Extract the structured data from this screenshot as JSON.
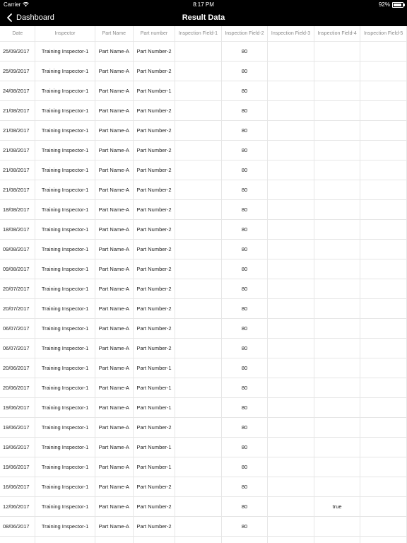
{
  "status_bar": {
    "carrier": "Carrier",
    "time": "8:17 PM",
    "battery": "92%",
    "battery_level": 0.92
  },
  "nav": {
    "back_label": "Dashboard",
    "title": "Result Data"
  },
  "table": {
    "columns": [
      "Date",
      "Inspector",
      "Part Name",
      "Part number",
      "Inspection Field-1",
      "Inspection Field-2",
      "Inspection Field-3",
      "Inspection Field-4",
      "Inspection Field-5"
    ],
    "rows": [
      [
        "25/09/2017",
        "Training Inspector-1",
        "Part Name-A",
        "Part Number-2",
        "",
        "80",
        "",
        "",
        ""
      ],
      [
        "25/09/2017",
        "Training Inspector-1",
        "Part Name-A",
        "Part Number-2",
        "",
        "80",
        "",
        "",
        ""
      ],
      [
        "24/08/2017",
        "Training Inspector-1",
        "Part Name-A",
        "Part Number-1",
        "",
        "80",
        "",
        "",
        ""
      ],
      [
        "21/08/2017",
        "Training Inspector-1",
        "Part Name-A",
        "Part Number-2",
        "",
        "80",
        "",
        "",
        ""
      ],
      [
        "21/08/2017",
        "Training Inspector-1",
        "Part Name-A",
        "Part Number-2",
        "",
        "80",
        "",
        "",
        ""
      ],
      [
        "21/08/2017",
        "Training Inspector-1",
        "Part Name-A",
        "Part Number-2",
        "",
        "80",
        "",
        "",
        ""
      ],
      [
        "21/08/2017",
        "Training Inspector-1",
        "Part Name-A",
        "Part Number-2",
        "",
        "80",
        "",
        "",
        ""
      ],
      [
        "21/08/2017",
        "Training Inspector-1",
        "Part Name-A",
        "Part Number-2",
        "",
        "80",
        "",
        "",
        ""
      ],
      [
        "18/08/2017",
        "Training Inspector-1",
        "Part Name-A",
        "Part Number-2",
        "",
        "80",
        "",
        "",
        ""
      ],
      [
        "18/08/2017",
        "Training Inspector-1",
        "Part Name-A",
        "Part Number-2",
        "",
        "80",
        "",
        "",
        ""
      ],
      [
        "09/08/2017",
        "Training Inspector-1",
        "Part Name-A",
        "Part Number-2",
        "",
        "80",
        "",
        "",
        ""
      ],
      [
        "09/08/2017",
        "Training Inspector-1",
        "Part Name-A",
        "Part Number-2",
        "",
        "80",
        "",
        "",
        ""
      ],
      [
        "20/07/2017",
        "Training Inspector-1",
        "Part Name-A",
        "Part Number-2",
        "",
        "80",
        "",
        "",
        ""
      ],
      [
        "20/07/2017",
        "Training Inspector-1",
        "Part Name-A",
        "Part Number-2",
        "",
        "80",
        "",
        "",
        ""
      ],
      [
        "06/07/2017",
        "Training Inspector-1",
        "Part Name-A",
        "Part Number-2",
        "",
        "80",
        "",
        "",
        ""
      ],
      [
        "06/07/2017",
        "Training Inspector-1",
        "Part Name-A",
        "Part Number-2",
        "",
        "80",
        "",
        "",
        ""
      ],
      [
        "20/06/2017",
        "Training Inspector-1",
        "Part Name-A",
        "Part Number-1",
        "",
        "80",
        "",
        "",
        ""
      ],
      [
        "20/06/2017",
        "Training Inspector-1",
        "Part Name-A",
        "Part Number-1",
        "",
        "80",
        "",
        "",
        ""
      ],
      [
        "19/06/2017",
        "Training Inspector-1",
        "Part Name-A",
        "Part Number-1",
        "",
        "80",
        "",
        "",
        ""
      ],
      [
        "19/06/2017",
        "Training Inspector-1",
        "Part Name-A",
        "Part Number-2",
        "",
        "80",
        "",
        "",
        ""
      ],
      [
        "19/06/2017",
        "Training Inspector-1",
        "Part Name-A",
        "Part Number-1",
        "",
        "80",
        "",
        "",
        ""
      ],
      [
        "19/06/2017",
        "Training Inspector-1",
        "Part Name-A",
        "Part Number-1",
        "",
        "80",
        "",
        "",
        ""
      ],
      [
        "16/06/2017",
        "Training Inspector-1",
        "Part Name-A",
        "Part Number-2",
        "",
        "80",
        "",
        "",
        ""
      ],
      [
        "12/06/2017",
        "Training Inspector-1",
        "Part Name-A",
        "Part Number-2",
        "",
        "80",
        "",
        "true",
        ""
      ],
      [
        "08/06/2017",
        "Training Inspector-1",
        "Part Name-A",
        "Part Number-2",
        "",
        "80",
        "",
        "",
        ""
      ],
      [
        "",
        "",
        "",
        "",
        "",
        "",
        "",
        "",
        ""
      ]
    ]
  }
}
